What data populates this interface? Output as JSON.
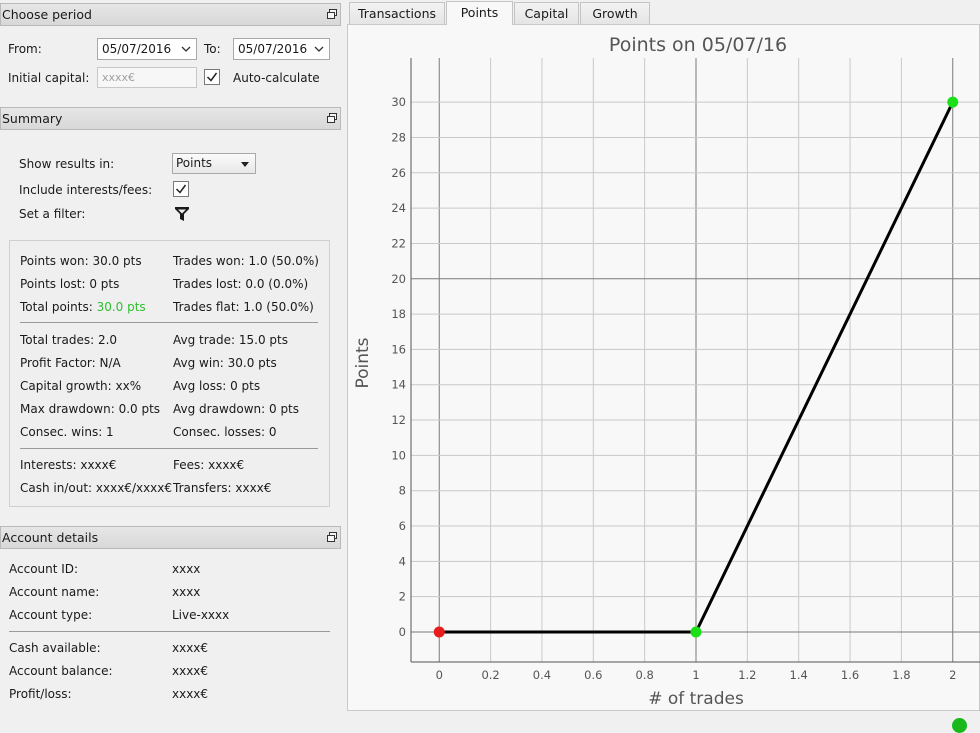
{
  "period": {
    "title": "Choose period",
    "from_label": "From:",
    "from_value": "05/07/2016",
    "to_label": "To:",
    "to_value": "05/07/2016",
    "capital_label": "Initial capital:",
    "capital_placeholder": "xxxx€",
    "autocalc_label": "Auto-calculate",
    "autocalc_checked": true
  },
  "summary": {
    "title": "Summary",
    "show_results_label": "Show results in:",
    "show_results_value": "Points",
    "include_label": "Include interests/fees:",
    "include_checked": true,
    "filter_label": "Set a filter:",
    "points_won": "Points won: 30.0 pts",
    "points_lost": "Points lost: 0 pts",
    "total_points_label": "Total points:",
    "total_points_value": "30.0 pts",
    "trades_won": "Trades won: 1.0 (50.0%)",
    "trades_lost": "Trades lost: 0.0 (0.0%)",
    "trades_flat": "Trades flat: 1.0 (50.0%)",
    "total_trades": "Total trades: 2.0",
    "profit_factor": "Profit Factor: N/A",
    "capital_growth": "Capital growth: xx%",
    "max_drawdown": "Max drawdown: 0.0 pts",
    "consec_wins": "Consec. wins: 1",
    "avg_trade": "Avg trade: 15.0 pts",
    "avg_win": "Avg win: 30.0 pts",
    "avg_loss": "Avg loss: 0 pts",
    "avg_drawdown": "Avg drawdown: 0 pts",
    "consec_losses": "Consec. losses: 0",
    "interests": "Interests: xxxx€",
    "cash_inout": "Cash in/out: xxxx€/xxxx€",
    "fees": "Fees: xxxx€",
    "transfers": "Transfers: xxxx€",
    "positive_color": "#2fbf2f"
  },
  "account": {
    "title": "Account details",
    "rows": [
      {
        "label": "Account ID:",
        "value": "xxxx"
      },
      {
        "label": "Account name:",
        "value": "xxxx"
      },
      {
        "label": "Account type:",
        "value": "Live-xxxx"
      },
      {
        "label": "Cash available:",
        "value": "xxxx€"
      },
      {
        "label": "Account balance:",
        "value": "xxxx€"
      },
      {
        "label": "Profit/loss:",
        "value": "xxxx€"
      }
    ]
  },
  "tabs": [
    "Transactions",
    "Points",
    "Capital",
    "Growth"
  ],
  "active_tab": "Points",
  "chart_data": {
    "type": "line",
    "title": "Points on 05/07/16",
    "xlabel": "# of trades",
    "ylabel": "Points",
    "x": [
      0,
      1,
      2
    ],
    "y": [
      0,
      0,
      30
    ],
    "point_colors": [
      "#e81c1c",
      "#19e019",
      "#19e019"
    ],
    "line_color": "#000000",
    "xlim": [
      -0.11,
      2.11
    ],
    "ylim": [
      -1.7,
      32.5
    ],
    "xticks": [
      0,
      0.2,
      0.4,
      0.6,
      0.8,
      1,
      1.2,
      1.4,
      1.6,
      1.8,
      2
    ],
    "yticks": [
      0,
      2,
      4,
      6,
      8,
      10,
      12,
      14,
      16,
      18,
      20,
      22,
      24,
      26,
      28,
      30
    ],
    "grid": true
  },
  "status": {
    "connection_color": "#1ab81a"
  }
}
